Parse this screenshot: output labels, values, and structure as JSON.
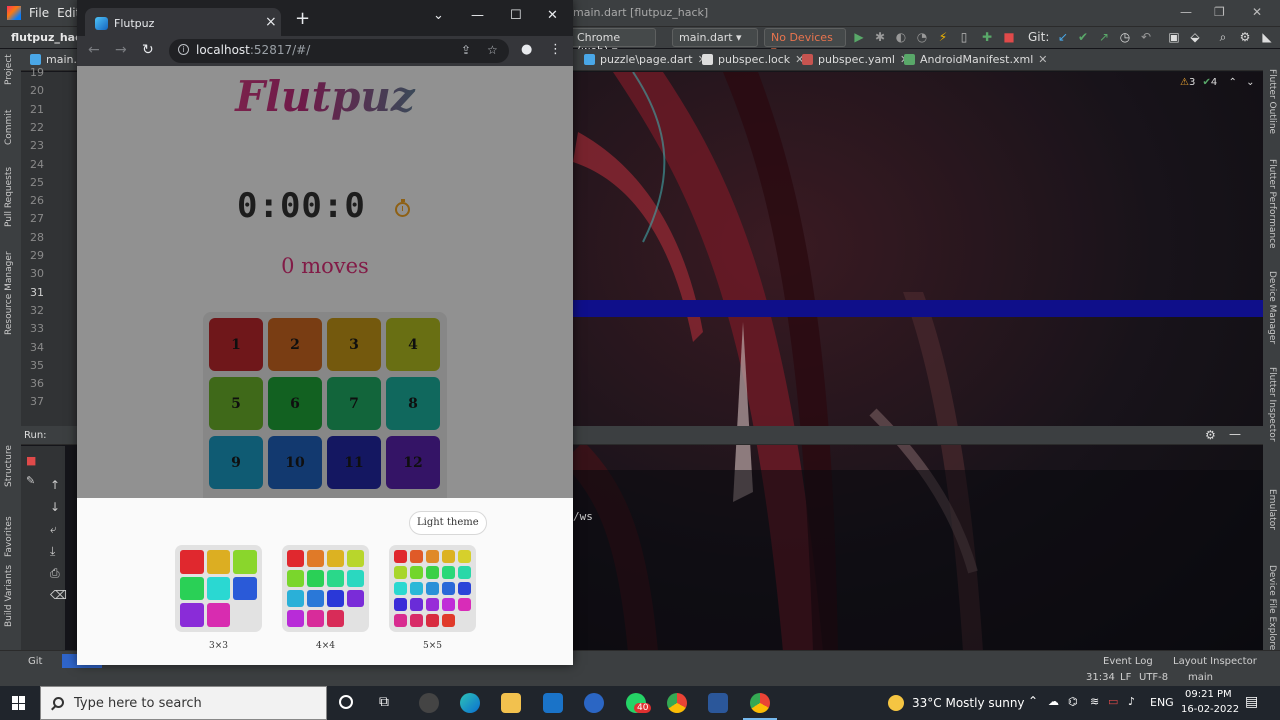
{
  "ide": {
    "menu": [
      "File",
      "Edit"
    ],
    "title": "main.dart [flutpuz_hack]",
    "project_name": "flutpuz_hack",
    "run_config": "main.dart",
    "device_target": "Chrome (web)",
    "devices": "No Devices",
    "git_label": "Git:",
    "tabs": [
      "main.da",
      "puzzle\\page.dart",
      "pubspec.lock",
      "pubspec.yaml",
      "AndroidManifest.xml"
    ],
    "inspections": {
      "warnings": "3",
      "ok": "4"
    },
    "line_numbers": [
      "19",
      "20",
      "21",
      "22",
      "23",
      "24",
      "25",
      "26",
      "27",
      "28",
      "29",
      "30",
      "31",
      "32",
      "33",
      "34",
      "35",
      "36",
      "37"
    ],
    "active_line": "31",
    "left_tools": [
      "Project",
      "Commit",
      "Pull Requests",
      "Resource Manager",
      "Structure",
      "Favorites",
      "Build Variants"
    ],
    "right_tools": [
      "Flutter Outline",
      "Flutter Performance",
      "Device Manager",
      "Flutter Inspector",
      "Emulator",
      "Device File Explorer"
    ],
    "run_label": "Run:",
    "console_line": "/ws",
    "status": {
      "git_tab": "Git",
      "event_log": "Event Log",
      "layout_inspector": "Layout Inspector",
      "position": "31:34",
      "line_sep": "LF",
      "encoding": "UTF-8",
      "branch": "main"
    }
  },
  "browser": {
    "tab_title": "Flutpuz",
    "url_host": "localhost",
    "url_rest": ":52817/#/"
  },
  "app": {
    "title": "Flutpuz",
    "timer": "0:00:0",
    "moves": "0 moves",
    "tiles": [
      {
        "n": "1",
        "color": "#c0282d"
      },
      {
        "n": "2",
        "color": "#d06a22"
      },
      {
        "n": "3",
        "color": "#c99a18"
      },
      {
        "n": "4",
        "color": "#b5c021"
      },
      {
        "n": "5",
        "color": "#6db62b"
      },
      {
        "n": "6",
        "color": "#1fa83a"
      },
      {
        "n": "7",
        "color": "#1fae67"
      },
      {
        "n": "8",
        "color": "#1db3a0"
      },
      {
        "n": "9",
        "color": "#1a9ec6"
      },
      {
        "n": "10",
        "color": "#1f63c0"
      },
      {
        "n": "11",
        "color": "#2328a8"
      },
      {
        "n": "12",
        "color": "#5b23b0"
      }
    ],
    "theme_button": "Light theme",
    "sizes": [
      {
        "label": "3×3",
        "colors": [
          "#e0282e",
          "#dcae22",
          "#8ad62c",
          "#2ad056",
          "#2ad8d2",
          "#2a5ad8",
          "#8a2cd8",
          "#d82cb0",
          "#e0e0e0"
        ]
      },
      {
        "label": "4×4",
        "colors": [
          "#e0282e",
          "#e07a28",
          "#dcb222",
          "#b8d62c",
          "#7ad62c",
          "#2ad056",
          "#2ad88a",
          "#2ad8c0",
          "#2ab0d8",
          "#2a78d8",
          "#2a38d8",
          "#7a2cd8",
          "#b82cd8",
          "#d82c9a",
          "#d82c58",
          "#e0e0e0"
        ]
      },
      {
        "label": "5×5",
        "colors": [
          "#e0282e",
          "#e05a28",
          "#e08a28",
          "#dcb222",
          "#d6d02c",
          "#a8d62c",
          "#72d62c",
          "#3ad046",
          "#2ad878",
          "#2ad8a8",
          "#2ad8d0",
          "#2ab8d8",
          "#2a90d8",
          "#2a68d8",
          "#2a44d8",
          "#3a2cd8",
          "#6a2cd8",
          "#982cd8",
          "#c02cd8",
          "#d82cb8",
          "#d82c90",
          "#d82c68",
          "#d82c40",
          "#e03a2a",
          "#e0e0e0"
        ]
      }
    ]
  },
  "taskbar": {
    "search_placeholder": "Type here to search",
    "whatsapp_badge": "40",
    "weather": "33°C  Mostly sunny",
    "lang": "ENG",
    "time": "09:21 PM",
    "date": "16-02-2022"
  }
}
